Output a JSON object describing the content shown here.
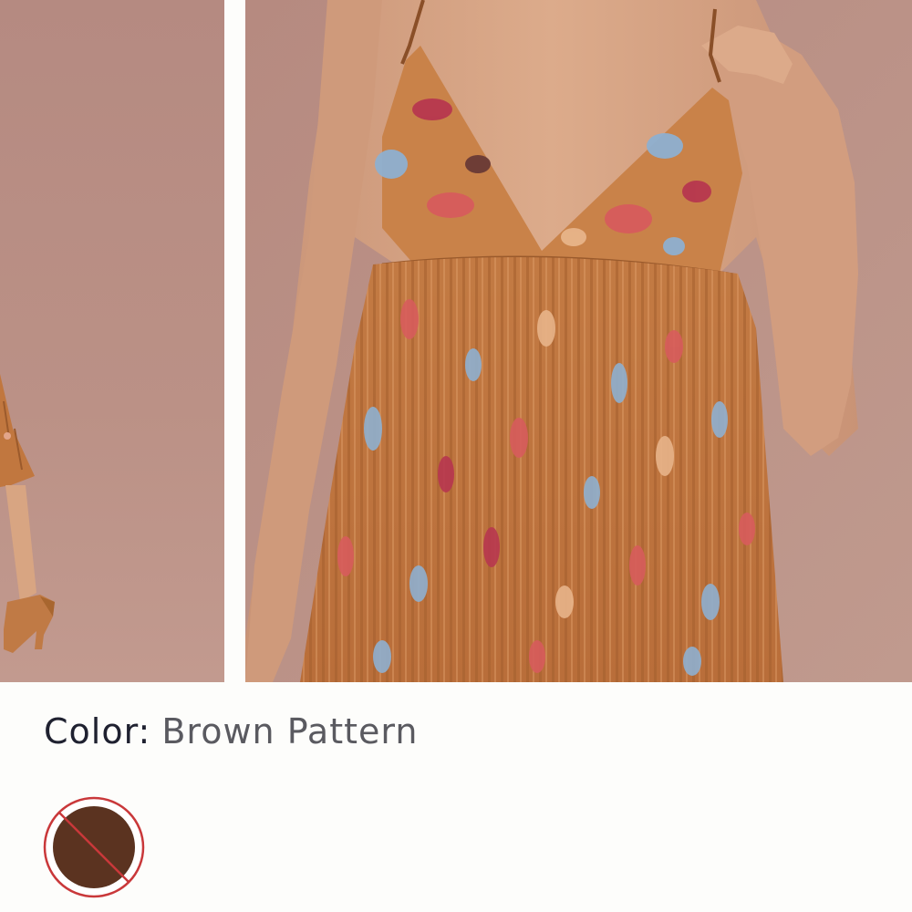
{
  "product": {
    "color_key": "Color:",
    "color_value": "Brown Pattern"
  },
  "gallery": {
    "images": [
      {
        "name": "model-full-length-image"
      },
      {
        "name": "model-close-up-image"
      }
    ]
  },
  "swatches": [
    {
      "name": "Brown Pattern",
      "color": "#5b3320",
      "ring": "#c9383a",
      "unavailable": true
    }
  ],
  "colors": {
    "backdrop": "#b88c80",
    "dress": "#c1773f",
    "skin": "#d8a582",
    "page": "#fdfdfb",
    "text_dark": "#1f2130",
    "text_muted": "#5a5a60"
  }
}
